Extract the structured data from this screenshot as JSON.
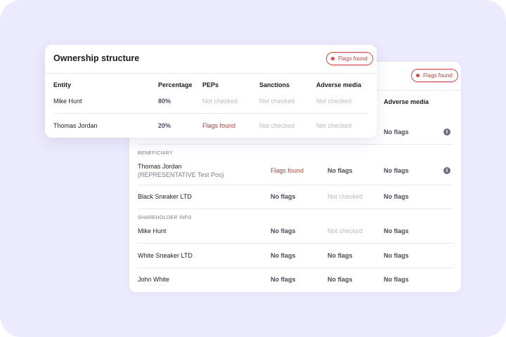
{
  "ownership": {
    "title": "Ownership structure",
    "flags_badge": "Flags found",
    "headers": [
      "Entity",
      "Percentage",
      "PEPs",
      "Sanctions",
      "Adverse media"
    ],
    "rows": [
      {
        "entity": "Mike Hunt",
        "percentage": "80%",
        "peps": "Not checked",
        "sanctions": "Not checked",
        "adverse": "Not checked"
      },
      {
        "entity": "Thomas Jordan",
        "percentage": "20%",
        "peps": "Flags found",
        "sanctions": "Not checked",
        "adverse": "Not checked"
      }
    ]
  },
  "screening": {
    "flags_badge": "Flags found",
    "header_adverse": "Adverse media",
    "top_row_adverse": "No flags",
    "beneficiary_label": "BENEFICIARY",
    "beneficiary_rows": [
      {
        "name": "Thomas Jordan",
        "sub": "(REPRESENTATIVE Test Pos)",
        "peps": "Flags found",
        "sanctions": "No flags",
        "adverse": "No flags"
      },
      {
        "name": "Black Sneaker LTD",
        "peps": "No flags",
        "sanctions": "Not checked",
        "adverse": "No flags"
      }
    ],
    "shareholder_label": "SHAREHOLDER INFO",
    "shareholder_rows": [
      {
        "name": "Mike Hunt",
        "peps": "No flags",
        "sanctions": "Not checked",
        "adverse": "No flags"
      },
      {
        "name": "White Sneaker LTD",
        "peps": "No flags",
        "sanctions": "No flags",
        "adverse": "No flags"
      },
      {
        "name": "John White",
        "peps": "No flags",
        "sanctions": "No flags",
        "adverse": "No flags"
      }
    ]
  },
  "colors": {
    "background": "#ecebfd",
    "flag_red": "#d9342b",
    "muted": "#b9b9c4"
  },
  "icons": {
    "info": "info-icon",
    "flag_dot": "flag-dot-icon"
  }
}
